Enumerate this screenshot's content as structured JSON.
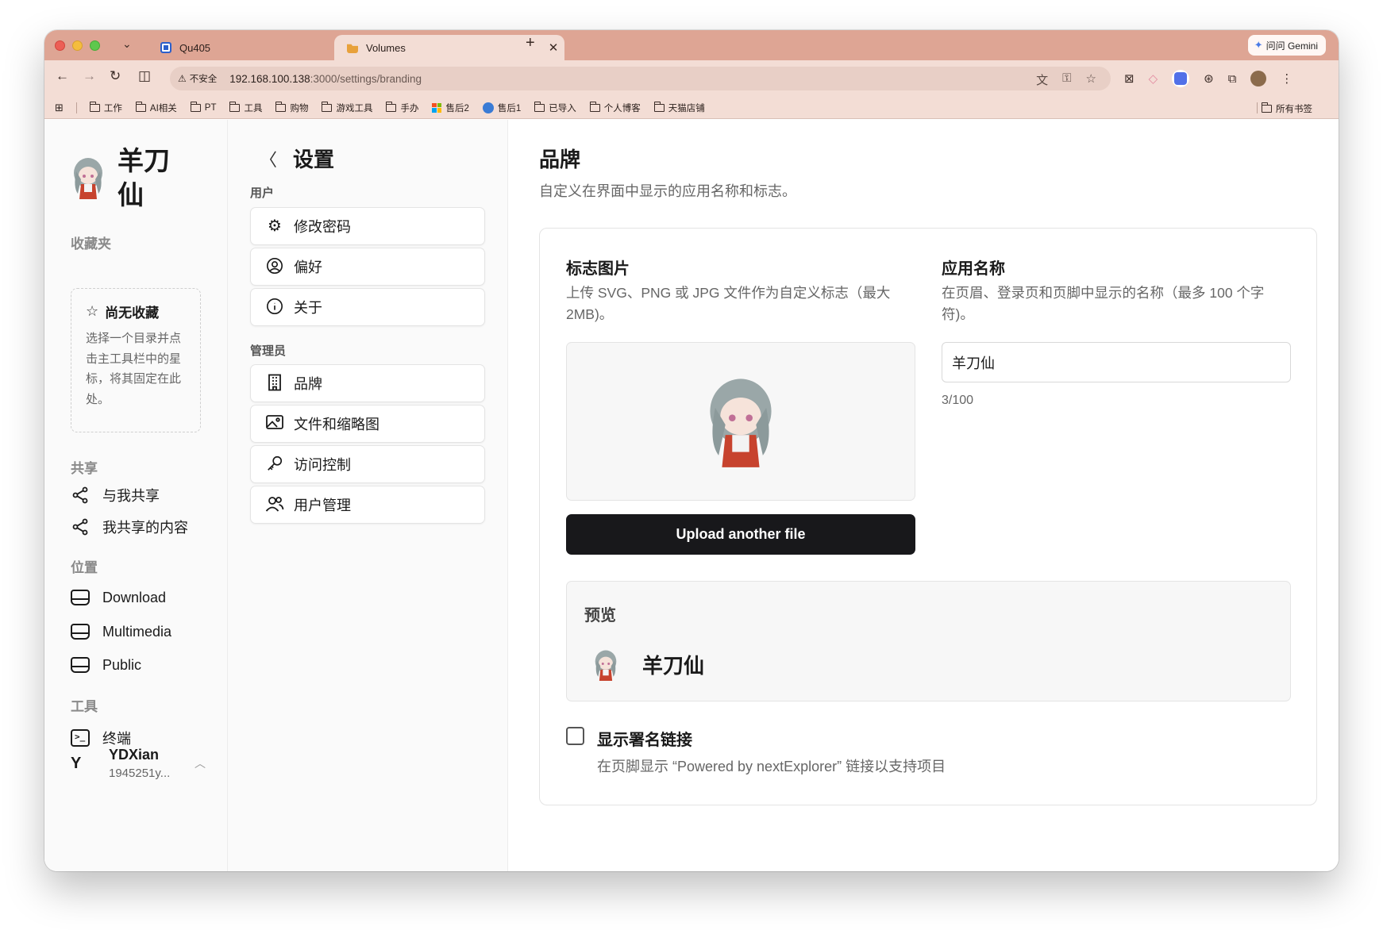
{
  "browser": {
    "tabs": [
      {
        "title": "Qu405",
        "active": false
      },
      {
        "title": "Volumes",
        "active": true
      }
    ],
    "gemini_label": "问问 Gemini",
    "address": {
      "insecure_label": "不安全",
      "host": "192.168.100.138",
      "path": ":3000/settings/branding"
    },
    "bookmarks": [
      "工作",
      "AI相关",
      "PT",
      "工具",
      "购物",
      "游戏工具",
      "手办",
      "售后2",
      "售后1",
      "已导入",
      "个人博客",
      "天猫店铺"
    ],
    "all_bookmarks_label": "所有书签"
  },
  "sidebar": {
    "app_name": "羊刀仙",
    "favorites_title": "收藏夹",
    "favorites_empty_title": "尚无收藏",
    "favorites_empty_desc": "选择一个目录并点击主工具栏中的星标，将其固定在此处。",
    "share_title": "共享",
    "share_items": [
      "与我共享",
      "我共享的内容"
    ],
    "location_title": "位置",
    "locations": [
      "Download",
      "Multimedia",
      "Public"
    ],
    "tools_title": "工具",
    "tools": [
      "终端"
    ],
    "user": {
      "initial": "Y",
      "name": "YDXian",
      "email": "1945251y..."
    }
  },
  "settings_nav": {
    "title": "设置",
    "groups": [
      {
        "label": "用户",
        "items": [
          "修改密码",
          "偏好",
          "关于"
        ]
      },
      {
        "label": "管理员",
        "items": [
          "品牌",
          "文件和缩略图",
          "访问控制",
          "用户管理"
        ]
      }
    ]
  },
  "branding": {
    "title": "品牌",
    "subtitle": "自定义在界面中显示的应用名称和标志。",
    "logo": {
      "title": "标志图片",
      "desc": "上传 SVG、PNG 或 JPG 文件作为自定义标志（最大 2MB)。",
      "upload_label": "Upload another file"
    },
    "app_name": {
      "title": "应用名称",
      "desc": "在页眉、登录页和页脚中显示的名称（最多 100 个字符)。",
      "value": "羊刀仙",
      "count": "3/100"
    },
    "preview": {
      "label": "预览",
      "name": "羊刀仙"
    },
    "attribution": {
      "label": "显示署名链接",
      "desc": "在页脚显示 “Powered by nextExplorer” 链接以支持项目",
      "checked": false
    }
  }
}
